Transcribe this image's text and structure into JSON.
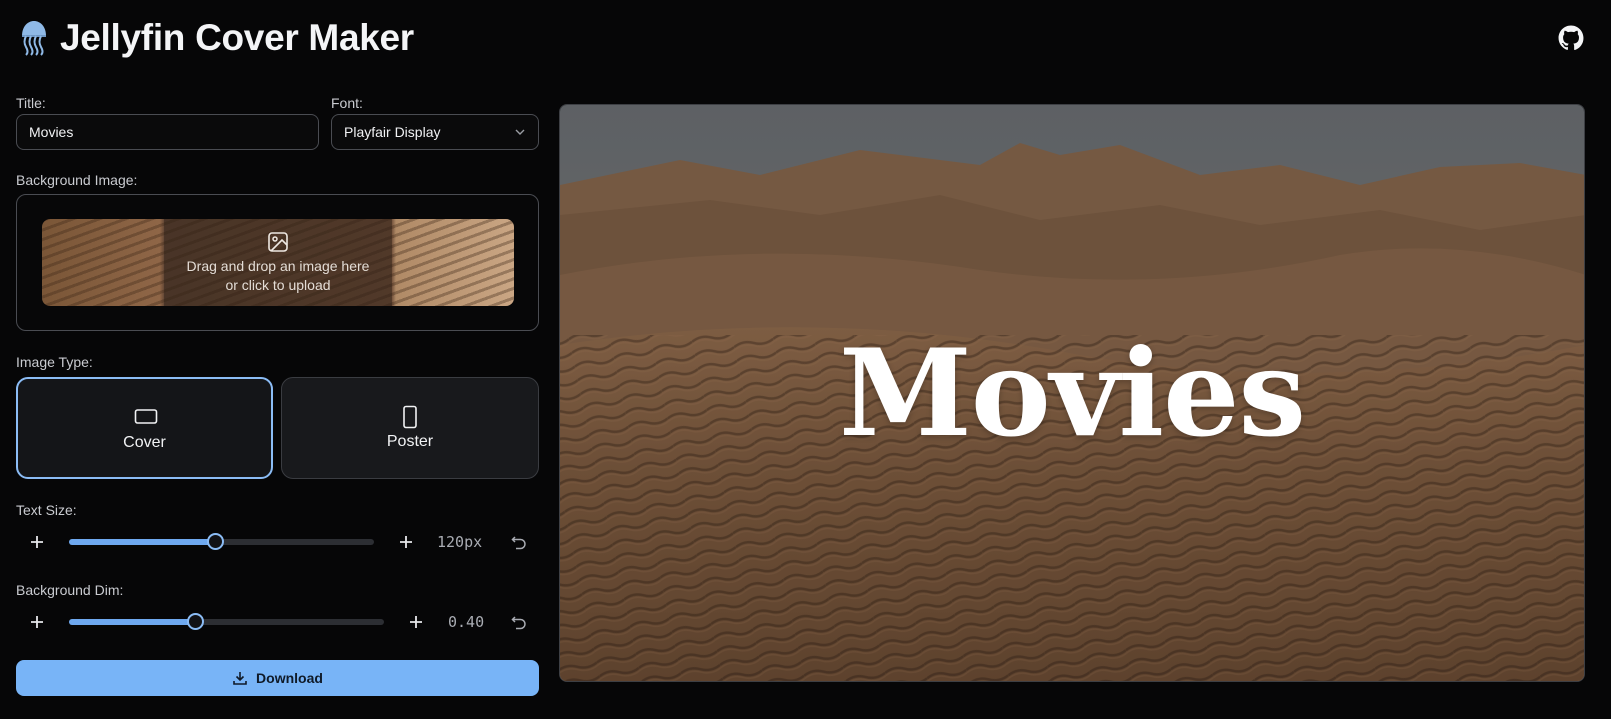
{
  "app": {
    "title": "Jellyfin Cover Maker",
    "logo_emoji": "🪼"
  },
  "header": {
    "github_icon": "github-icon"
  },
  "form": {
    "title_label": "Title:",
    "title_value": "Movies",
    "font_label": "Font:",
    "font_value": "Playfair Display",
    "background_label": "Background Image:",
    "dropzone_line1": "Drag and drop an image here",
    "dropzone_line2": "or click to upload",
    "image_type_label": "Image Type:",
    "image_types": [
      {
        "label": "Cover",
        "icon": "landscape-rect-icon",
        "selected": true
      },
      {
        "label": "Poster",
        "icon": "portrait-rect-icon",
        "selected": false
      }
    ],
    "text_size": {
      "label": "Text Size:",
      "value_text": "120px",
      "fraction": 0.48
    },
    "background_dim": {
      "label": "Background Dim:",
      "value_text": "0.40",
      "fraction": 0.4
    },
    "download_label": "Download"
  },
  "preview": {
    "title": "Movies"
  },
  "colors": {
    "accent": "#78b4f7",
    "background": "#060607",
    "card": "#18191c"
  }
}
